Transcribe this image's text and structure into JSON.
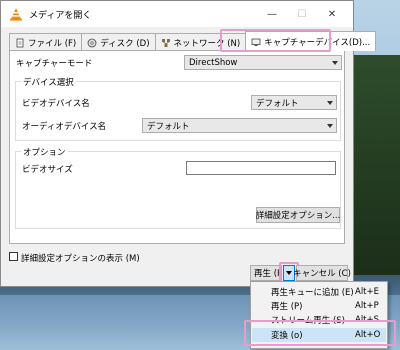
{
  "window": {
    "title": "メディアを開く",
    "close": "✕",
    "maximize": "☐",
    "minimize": "—"
  },
  "tabs": [
    {
      "label": "ファイル (F)",
      "icon": "file-icon"
    },
    {
      "label": "ディスク (D)",
      "icon": "disc-icon"
    },
    {
      "label": "ネットワーク (N)",
      "icon": "network-icon"
    },
    {
      "label": "キャプチャーデバイス(D)...",
      "icon": "capture-device-icon",
      "active": true
    }
  ],
  "capture": {
    "mode_label": "キャプチャーモード",
    "mode_value": "DirectShow",
    "device_group": "デバイス選択",
    "video_label": "ビデオデバイス名",
    "video_value": "デフォルト",
    "audio_label": "オーディオデバイス名",
    "audio_value": "デフォルト",
    "options_group": "オプション",
    "video_size_label": "ビデオサイズ",
    "video_size_value": "",
    "advanced_button": "詳細設定オプション..."
  },
  "footer": {
    "show_advanced_label": "詳細設定オプションの表示 (M)",
    "show_advanced_checked": false,
    "play_label": "再生 (P",
    "cancel_label": "キャンセル (C)"
  },
  "menu": {
    "items": [
      {
        "label": "再生キューに追加 (E)",
        "shortcut": "Alt+E"
      },
      {
        "label": "再生 (P)",
        "shortcut": "Alt+P"
      },
      {
        "label": "ストリーム再生 (S)",
        "shortcut": "Alt+S"
      },
      {
        "label": "変換 (o)",
        "shortcut": "Alt+O",
        "selected": true
      }
    ]
  },
  "colors": {
    "highlight_border": "#e79ccf",
    "selection_fill": "#cce4f7",
    "vlc_orange": "#f28b0c"
  }
}
